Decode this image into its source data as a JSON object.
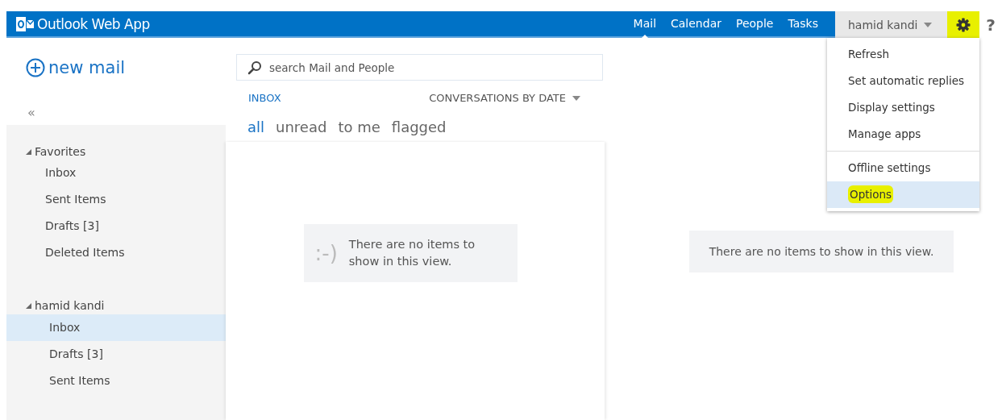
{
  "app": {
    "title": "Outlook Web App"
  },
  "nav": [
    {
      "label": "Mail",
      "selected": true
    },
    {
      "label": "Calendar",
      "selected": false
    },
    {
      "label": "People",
      "selected": false
    },
    {
      "label": "Tasks",
      "selected": false
    }
  ],
  "user": {
    "name": "hamid kandi"
  },
  "settings": {
    "highlighted": true
  },
  "help": {
    "label": "?"
  },
  "settings_menu": {
    "groups": [
      [
        {
          "label": "Refresh",
          "selected": false,
          "highlighted": false
        },
        {
          "label": "Set automatic replies",
          "selected": false,
          "highlighted": false
        },
        {
          "label": "Display settings",
          "selected": false,
          "highlighted": false
        },
        {
          "label": "Manage apps",
          "selected": false,
          "highlighted": false
        }
      ],
      [
        {
          "label": "Offline settings",
          "selected": false,
          "highlighted": false
        },
        {
          "label": "Options",
          "selected": true,
          "highlighted": true
        }
      ]
    ]
  },
  "new_mail": {
    "label": "new mail"
  },
  "collapse": {
    "label": "«"
  },
  "folders": [
    {
      "label": "Favorites",
      "expanded": true,
      "children": [
        {
          "label": "Inbox",
          "selected": false
        },
        {
          "label": "Sent Items",
          "selected": false
        },
        {
          "label": "Drafts [3]",
          "selected": false
        },
        {
          "label": "Deleted Items",
          "selected": false
        }
      ]
    },
    {
      "label": "hamid kandi",
      "expanded": true,
      "children": [
        {
          "label": "Inbox",
          "selected": true
        },
        {
          "label": "Drafts [3]",
          "selected": false
        },
        {
          "label": "Sent Items",
          "selected": false
        }
      ]
    }
  ],
  "search": {
    "placeholder": "search Mail and People"
  },
  "folder_title": "INBOX",
  "sort": {
    "label": "CONVERSATIONS BY DATE"
  },
  "filters": [
    {
      "label": "all",
      "selected": true
    },
    {
      "label": "unread",
      "selected": false
    },
    {
      "label": "to me",
      "selected": false
    },
    {
      "label": "flagged",
      "selected": false
    }
  ],
  "message_list": {
    "emoticon": ":-)",
    "empty_text": "There are no items to show in this view."
  },
  "reading_pane": {
    "empty_text": "There are no items to show in this view."
  }
}
